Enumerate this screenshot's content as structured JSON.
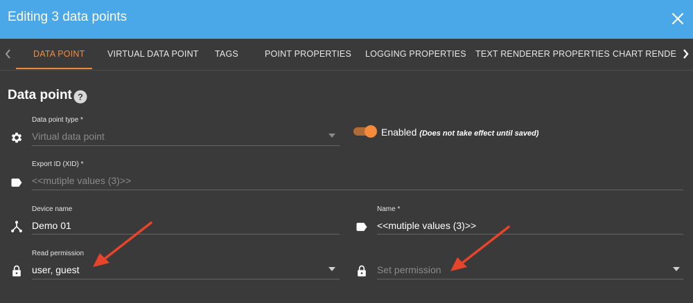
{
  "header": {
    "title": "Editing 3 data points",
    "close_icon": "close-icon",
    "color": "#4aa8e8"
  },
  "tabs": [
    {
      "label": "DATA POINT",
      "active": true
    },
    {
      "label": "VIRTUAL DATA POINT",
      "active": false
    },
    {
      "label": "TAGS",
      "active": false
    },
    {
      "label": "POINT PROPERTIES",
      "active": false
    },
    {
      "label": "LOGGING PROPERTIES",
      "active": false
    },
    {
      "label": "TEXT RENDERER PROPERTIES",
      "active": false
    },
    {
      "label": "CHART RENDERER",
      "active": false
    }
  ],
  "section": {
    "title": "Data point",
    "help_icon": "help-circle-icon"
  },
  "fields": {
    "type": {
      "label": "Data point type *",
      "value": "Virtual data point",
      "icon": "gear-icon"
    },
    "enabled": {
      "label": "Enabled",
      "note": "(Does not take effect until saved)",
      "on": true
    },
    "xid": {
      "label": "Export ID (XID) *",
      "value": "<<mutiple values (3)>>",
      "icon": "tag-icon"
    },
    "device": {
      "label": "Device name",
      "value": "Demo 01",
      "icon": "device-hub-icon"
    },
    "name": {
      "label": "Name *",
      "value": "<<mutiple values (3)>>",
      "icon": "tag-icon"
    },
    "read_permission": {
      "label": "Read permission",
      "value": "user, guest",
      "icon": "lock-icon"
    },
    "set_permission": {
      "placeholder": "Set permission",
      "icon": "lock-icon"
    }
  },
  "colors": {
    "accent": "#f58a3a",
    "background": "#3a3a3a",
    "annotation_arrow": "#e8442a"
  }
}
